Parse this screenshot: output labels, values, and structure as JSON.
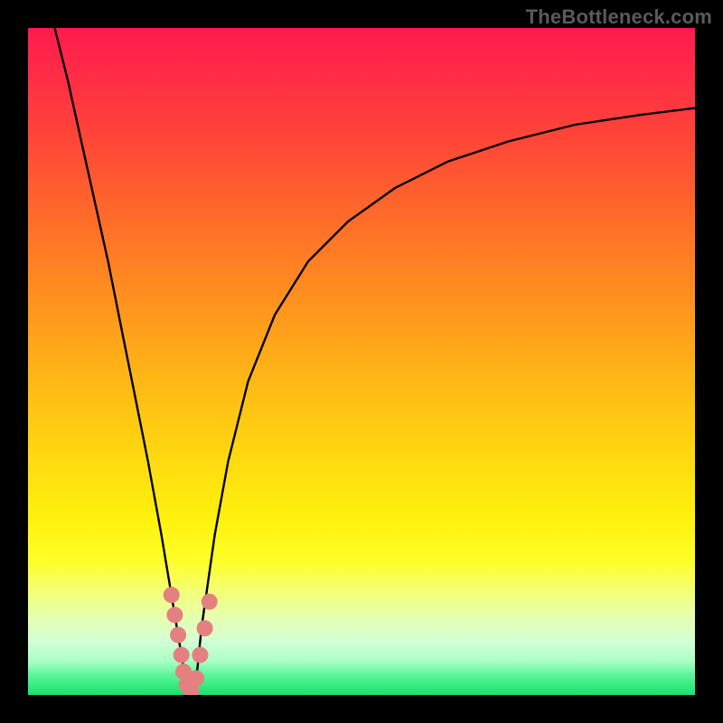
{
  "watermark": "TheBottleneck.com",
  "colors": {
    "frame": "#000000",
    "curve": "#000000",
    "marker": "#e48080",
    "gradient_top": "#ff1a4e",
    "gradient_bottom": "#14e46a"
  },
  "chart_data": {
    "type": "line",
    "title": "",
    "xlabel": "",
    "ylabel": "",
    "xlim": [
      0,
      100
    ],
    "ylim": [
      0,
      100
    ],
    "grid": false,
    "legend": false,
    "series": [
      {
        "name": "left-branch",
        "x": [
          4,
          6,
          8,
          10,
          12,
          14,
          16,
          18,
          20,
          22,
          23,
          24
        ],
        "values": [
          100,
          92,
          83,
          74,
          65,
          55,
          45,
          35,
          24,
          12,
          6,
          0
        ]
      },
      {
        "name": "right-branch",
        "x": [
          25,
          26,
          28,
          30,
          33,
          37,
          42,
          48,
          55,
          63,
          72,
          82,
          92,
          100
        ],
        "values": [
          0,
          10,
          24,
          35,
          47,
          57,
          65,
          71,
          76,
          80,
          83,
          85.5,
          87,
          88
        ]
      }
    ],
    "markers": [
      {
        "series": "left-branch",
        "x": 21.5,
        "y": 15
      },
      {
        "series": "left-branch",
        "x": 22.0,
        "y": 12
      },
      {
        "series": "left-branch",
        "x": 22.5,
        "y": 9
      },
      {
        "series": "left-branch",
        "x": 23.0,
        "y": 6
      },
      {
        "series": "left-branch",
        "x": 23.3,
        "y": 3.5
      },
      {
        "series": "left-branch",
        "x": 23.8,
        "y": 1.5
      },
      {
        "series": "right-branch",
        "x": 24.5,
        "y": 0.5
      },
      {
        "series": "right-branch",
        "x": 25.2,
        "y": 2.5
      },
      {
        "series": "right-branch",
        "x": 25.8,
        "y": 6
      },
      {
        "series": "right-branch",
        "x": 26.5,
        "y": 10
      },
      {
        "series": "right-branch",
        "x": 27.2,
        "y": 14
      }
    ]
  }
}
